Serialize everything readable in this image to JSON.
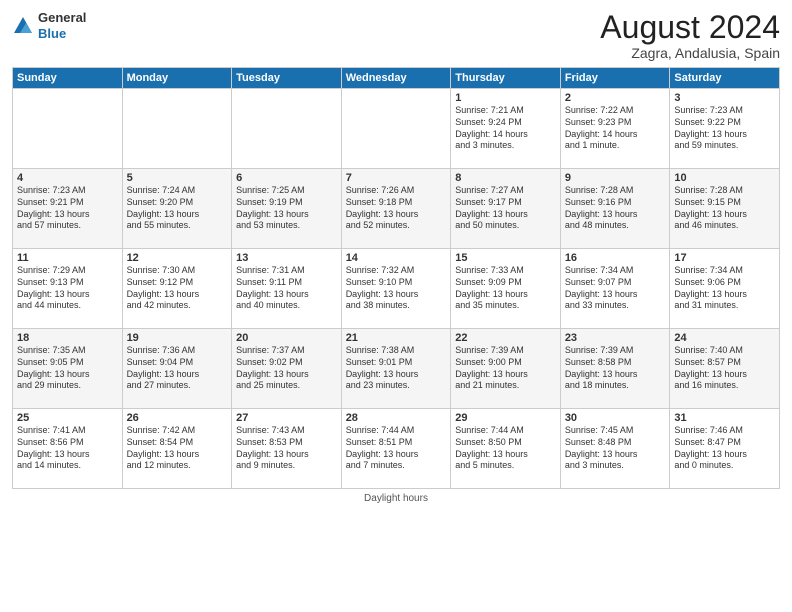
{
  "header": {
    "logo_general": "General",
    "logo_blue": "Blue",
    "month_title": "August 2024",
    "location": "Zagra, Andalusia, Spain"
  },
  "days_of_week": [
    "Sunday",
    "Monday",
    "Tuesday",
    "Wednesday",
    "Thursday",
    "Friday",
    "Saturday"
  ],
  "footer": {
    "note": "Daylight hours"
  },
  "weeks": [
    [
      {
        "day": "",
        "info": ""
      },
      {
        "day": "",
        "info": ""
      },
      {
        "day": "",
        "info": ""
      },
      {
        "day": "",
        "info": ""
      },
      {
        "day": "1",
        "info": "Sunrise: 7:21 AM\nSunset: 9:24 PM\nDaylight: 14 hours\nand 3 minutes."
      },
      {
        "day": "2",
        "info": "Sunrise: 7:22 AM\nSunset: 9:23 PM\nDaylight: 14 hours\nand 1 minute."
      },
      {
        "day": "3",
        "info": "Sunrise: 7:23 AM\nSunset: 9:22 PM\nDaylight: 13 hours\nand 59 minutes."
      }
    ],
    [
      {
        "day": "4",
        "info": "Sunrise: 7:23 AM\nSunset: 9:21 PM\nDaylight: 13 hours\nand 57 minutes."
      },
      {
        "day": "5",
        "info": "Sunrise: 7:24 AM\nSunset: 9:20 PM\nDaylight: 13 hours\nand 55 minutes."
      },
      {
        "day": "6",
        "info": "Sunrise: 7:25 AM\nSunset: 9:19 PM\nDaylight: 13 hours\nand 53 minutes."
      },
      {
        "day": "7",
        "info": "Sunrise: 7:26 AM\nSunset: 9:18 PM\nDaylight: 13 hours\nand 52 minutes."
      },
      {
        "day": "8",
        "info": "Sunrise: 7:27 AM\nSunset: 9:17 PM\nDaylight: 13 hours\nand 50 minutes."
      },
      {
        "day": "9",
        "info": "Sunrise: 7:28 AM\nSunset: 9:16 PM\nDaylight: 13 hours\nand 48 minutes."
      },
      {
        "day": "10",
        "info": "Sunrise: 7:28 AM\nSunset: 9:15 PM\nDaylight: 13 hours\nand 46 minutes."
      }
    ],
    [
      {
        "day": "11",
        "info": "Sunrise: 7:29 AM\nSunset: 9:13 PM\nDaylight: 13 hours\nand 44 minutes."
      },
      {
        "day": "12",
        "info": "Sunrise: 7:30 AM\nSunset: 9:12 PM\nDaylight: 13 hours\nand 42 minutes."
      },
      {
        "day": "13",
        "info": "Sunrise: 7:31 AM\nSunset: 9:11 PM\nDaylight: 13 hours\nand 40 minutes."
      },
      {
        "day": "14",
        "info": "Sunrise: 7:32 AM\nSunset: 9:10 PM\nDaylight: 13 hours\nand 38 minutes."
      },
      {
        "day": "15",
        "info": "Sunrise: 7:33 AM\nSunset: 9:09 PM\nDaylight: 13 hours\nand 35 minutes."
      },
      {
        "day": "16",
        "info": "Sunrise: 7:34 AM\nSunset: 9:07 PM\nDaylight: 13 hours\nand 33 minutes."
      },
      {
        "day": "17",
        "info": "Sunrise: 7:34 AM\nSunset: 9:06 PM\nDaylight: 13 hours\nand 31 minutes."
      }
    ],
    [
      {
        "day": "18",
        "info": "Sunrise: 7:35 AM\nSunset: 9:05 PM\nDaylight: 13 hours\nand 29 minutes."
      },
      {
        "day": "19",
        "info": "Sunrise: 7:36 AM\nSunset: 9:04 PM\nDaylight: 13 hours\nand 27 minutes."
      },
      {
        "day": "20",
        "info": "Sunrise: 7:37 AM\nSunset: 9:02 PM\nDaylight: 13 hours\nand 25 minutes."
      },
      {
        "day": "21",
        "info": "Sunrise: 7:38 AM\nSunset: 9:01 PM\nDaylight: 13 hours\nand 23 minutes."
      },
      {
        "day": "22",
        "info": "Sunrise: 7:39 AM\nSunset: 9:00 PM\nDaylight: 13 hours\nand 21 minutes."
      },
      {
        "day": "23",
        "info": "Sunrise: 7:39 AM\nSunset: 8:58 PM\nDaylight: 13 hours\nand 18 minutes."
      },
      {
        "day": "24",
        "info": "Sunrise: 7:40 AM\nSunset: 8:57 PM\nDaylight: 13 hours\nand 16 minutes."
      }
    ],
    [
      {
        "day": "25",
        "info": "Sunrise: 7:41 AM\nSunset: 8:56 PM\nDaylight: 13 hours\nand 14 minutes."
      },
      {
        "day": "26",
        "info": "Sunrise: 7:42 AM\nSunset: 8:54 PM\nDaylight: 13 hours\nand 12 minutes."
      },
      {
        "day": "27",
        "info": "Sunrise: 7:43 AM\nSunset: 8:53 PM\nDaylight: 13 hours\nand 9 minutes."
      },
      {
        "day": "28",
        "info": "Sunrise: 7:44 AM\nSunset: 8:51 PM\nDaylight: 13 hours\nand 7 minutes."
      },
      {
        "day": "29",
        "info": "Sunrise: 7:44 AM\nSunset: 8:50 PM\nDaylight: 13 hours\nand 5 minutes."
      },
      {
        "day": "30",
        "info": "Sunrise: 7:45 AM\nSunset: 8:48 PM\nDaylight: 13 hours\nand 3 minutes."
      },
      {
        "day": "31",
        "info": "Sunrise: 7:46 AM\nSunset: 8:47 PM\nDaylight: 13 hours\nand 0 minutes."
      }
    ]
  ]
}
